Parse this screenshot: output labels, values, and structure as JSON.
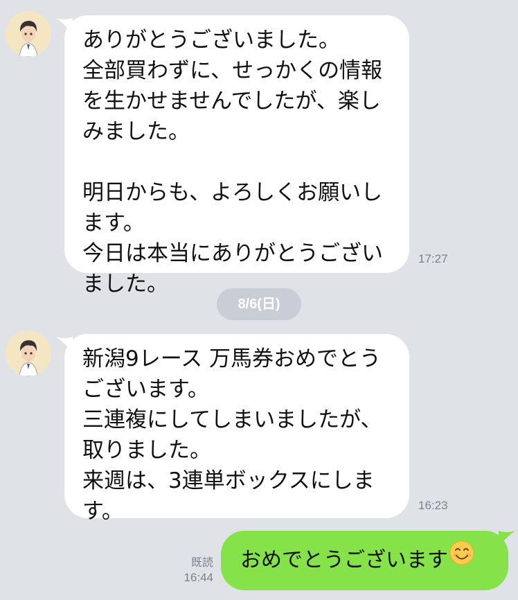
{
  "conversation": {
    "messages_in": [
      {
        "text": "ありがとうございました。\n全部買わずに、せっかくの情報\nを生かせませんでしたが、楽し\nみました。\n\n明日からも、よろしくお願いし\nます。\n今日は本当にありがとうござい\nました。",
        "time": "17:27"
      },
      {
        "text": "新潟9レース 万馬券おめでとう\nございます。\n三連複にしてしまいましたが、\n取りました。\n来週は、3連単ボックスにしま\nす。",
        "time": "16:23"
      }
    ],
    "date_separator": "8/6(日)",
    "message_out": {
      "text": "おめでとうございます",
      "emoji": "smiling-face-emoji",
      "read_label": "既読",
      "time": "16:44"
    }
  },
  "colors": {
    "background": "#dfe3e8",
    "incoming_bubble": "#ffffff",
    "outgoing_bubble": "#85e249",
    "timestamp": "#7c8189",
    "date_pill": "#c9ced6"
  },
  "icons": {
    "avatar": "anime-boy-avatar-icon",
    "emoji": "smiling-face-emoji"
  }
}
